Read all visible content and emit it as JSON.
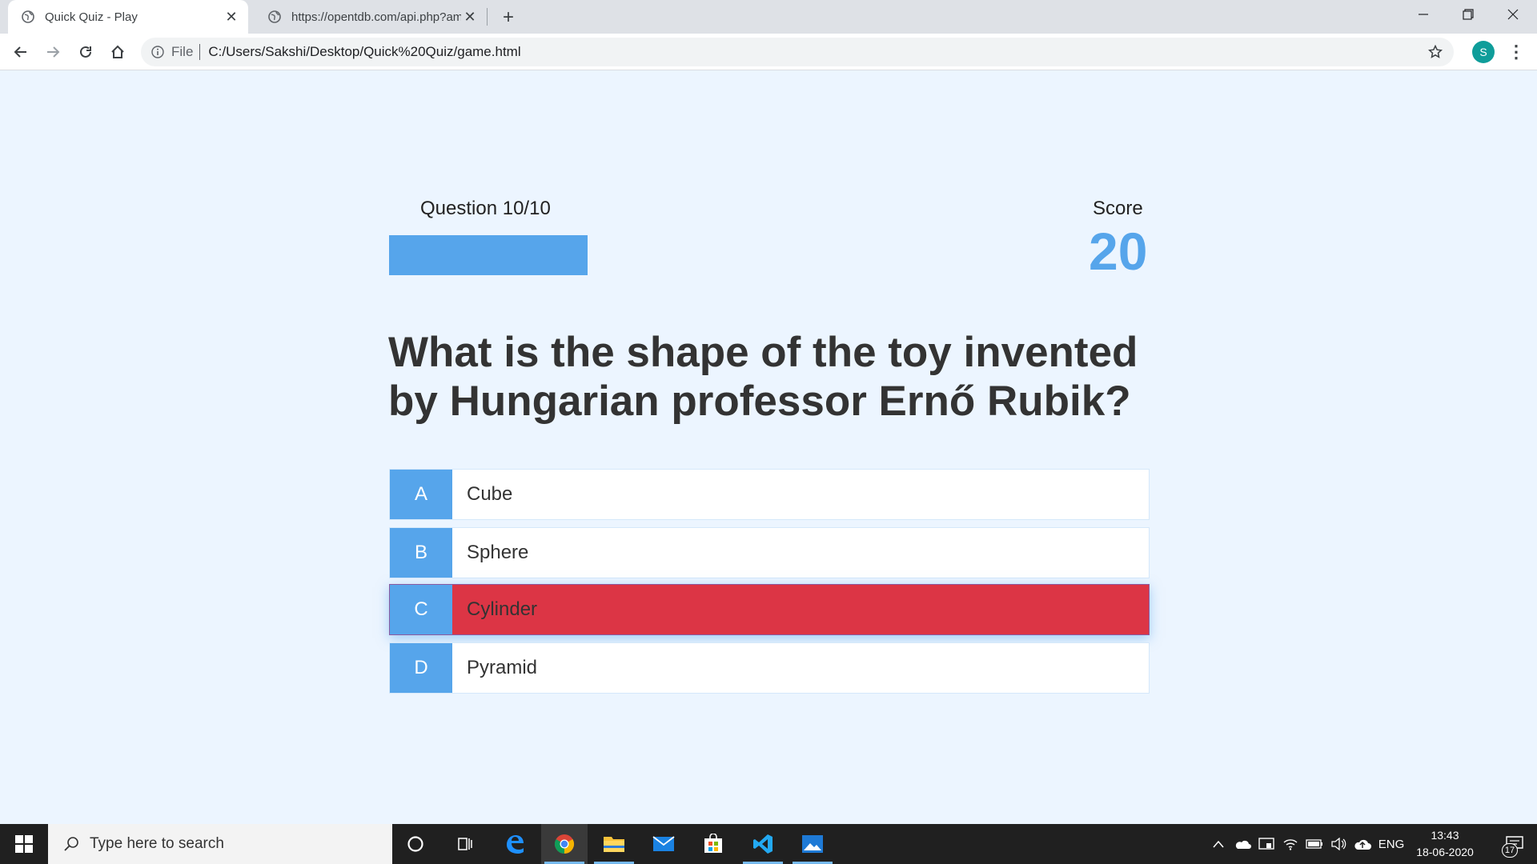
{
  "browser": {
    "tabs": [
      {
        "title": "Quick Quiz - Play",
        "active": true
      },
      {
        "title": "https://opentdb.com/api.php?am",
        "active": false
      }
    ],
    "address": {
      "scheme_label": "File",
      "url": "C:/Users/Sakshi/Desktop/Quick%20Quiz/game.html"
    },
    "profile_initial": "S"
  },
  "hud": {
    "question_label": "Question 10/10",
    "progress_fraction": 1.0,
    "score_label": "Score",
    "score_value": "20"
  },
  "question": "What is the shape of the toy invented by Hungarian professor Ernő Rubik?",
  "choices": [
    {
      "prefix": "A",
      "text": "Cube",
      "state": "default"
    },
    {
      "prefix": "B",
      "text": "Sphere",
      "state": "default"
    },
    {
      "prefix": "C",
      "text": "Cylinder",
      "state": "incorrect"
    },
    {
      "prefix": "D",
      "text": "Pyramid",
      "state": "default"
    }
  ],
  "colors": {
    "accent": "#56a5eb",
    "incorrect": "#dc3545",
    "page_bg": "#ecf5ff"
  },
  "taskbar": {
    "search_placeholder": "Type here to search",
    "language": "ENG",
    "time": "13:43",
    "date": "18-06-2020",
    "notification_count": "17",
    "apps": [
      "cortana-icon",
      "task-view-icon",
      "edge-icon",
      "chrome-icon",
      "file-explorer-icon",
      "mail-icon",
      "store-icon",
      "vscode-icon",
      "photos-icon"
    ]
  }
}
